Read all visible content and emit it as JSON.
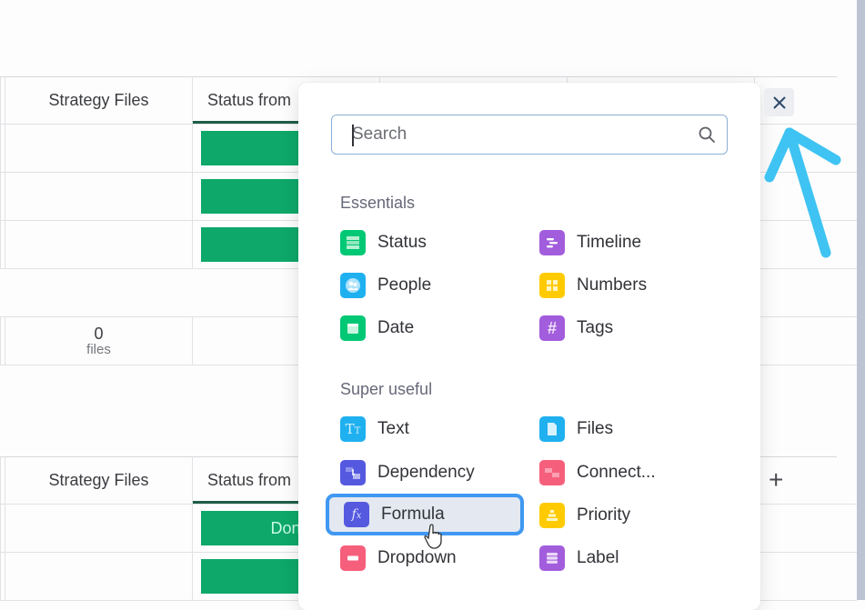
{
  "board_top": {
    "header": {
      "strategy_files": "Strategy Files",
      "status_from": "Status from"
    },
    "rows": [
      {
        "status_segments": [
          "green"
        ]
      },
      {
        "status_segments": [
          "green",
          "red"
        ]
      },
      {
        "status_segments": [
          "green"
        ]
      }
    ],
    "summary": {
      "files_count": "0",
      "files_label": "files"
    }
  },
  "board_bottom": {
    "header": {
      "strategy_files": "Strategy Files",
      "status_from": "Status from"
    },
    "rows": [
      {
        "status_label": "Done"
      },
      {
        "status_label": ""
      }
    ],
    "add_column_label": "+"
  },
  "column_picker": {
    "search": {
      "placeholder": "Search",
      "value": ""
    },
    "sections": [
      {
        "title": "Essentials",
        "items": [
          {
            "label": "Status",
            "icon": "status-icon",
            "color": "#00c875"
          },
          {
            "label": "Timeline",
            "icon": "timeline-icon",
            "color": "#a25ddc"
          },
          {
            "label": "People",
            "icon": "people-icon",
            "color": "#1fb0f0"
          },
          {
            "label": "Numbers",
            "icon": "numbers-icon",
            "color": "#ffcb00"
          },
          {
            "label": "Date",
            "icon": "date-icon",
            "color": "#00c875"
          },
          {
            "label": "Tags",
            "icon": "tags-icon",
            "color": "#a25ddc"
          }
        ]
      },
      {
        "title": "Super useful",
        "items": [
          {
            "label": "Text",
            "icon": "text-icon",
            "color": "#1fb0f0"
          },
          {
            "label": "Files",
            "icon": "files-icon",
            "color": "#1fb0f0"
          },
          {
            "label": "Dependency",
            "icon": "dependency-icon",
            "color": "#5559df"
          },
          {
            "label": "Connect...",
            "icon": "connect-boards-icon",
            "color": "#f65f7c"
          },
          {
            "label": "Formula",
            "icon": "formula-icon",
            "color": "#5559df",
            "selected": true
          },
          {
            "label": "Priority",
            "icon": "priority-icon",
            "color": "#ffcb00"
          },
          {
            "label": "Dropdown",
            "icon": "dropdown-icon",
            "color": "#f65f7c"
          },
          {
            "label": "Label",
            "icon": "label-icon",
            "color": "#a25ddc"
          }
        ]
      }
    ],
    "close_icon": "close-icon"
  },
  "colors": {
    "status_green": "#0ea86a",
    "status_red": "#e2445c",
    "highlight_blue": "#3f98f2",
    "annotation_arrow": "#3ec3f2"
  }
}
